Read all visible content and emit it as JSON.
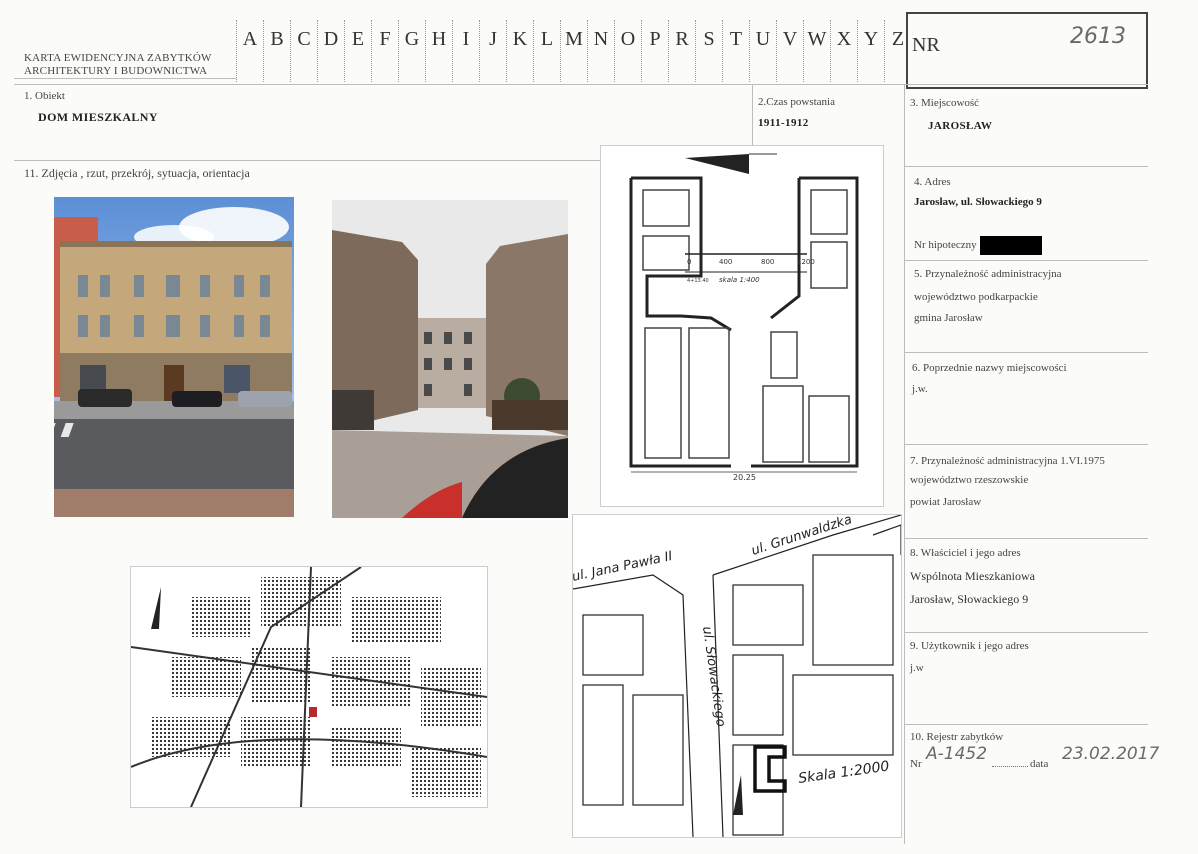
{
  "header": {
    "title_line1": "KARTA EWIDENCYJNA ZABYTKÓW",
    "title_line2": "ARCHITEKTURY I BUDOWNICTWA",
    "letters": [
      "A",
      "B",
      "C",
      "D",
      "E",
      "F",
      "G",
      "H",
      "I",
      "J",
      "K",
      "L",
      "M",
      "N",
      "O",
      "P",
      "R",
      "S",
      "T",
      "U",
      "V",
      "W",
      "X",
      "Y",
      "Z"
    ],
    "nr_label": "NR",
    "nr_value": "2613"
  },
  "sections": {
    "s1_label": "1. Obiekt",
    "s1_value": "DOM MIESZKALNY",
    "s2_label": "2.Czas powstania",
    "s2_value": "1911-1912",
    "s3_label": "3. Miejscowość",
    "s3_value": "JAROSŁAW",
    "s4_label": "4. Adres",
    "s4_value": "Jarosław, ul. Słowackiego 9",
    "s4_hipo": "Nr hipoteczny",
    "s5_label": "5. Przynależność administracyjna",
    "s5_line1": "województwo   podkarpackie",
    "s5_line2": "gmina  Jarosław",
    "s6_label": "6. Poprzednie nazwy miejscowości",
    "s6_value": "j.w.",
    "s7_label": "7. Przynależność administracyjna 1.VI.1975",
    "s7_line1": "województwo  rzeszowskie",
    "s7_line2": "powiat   Jarosław",
    "s8_label": "8. Właściciel i jego adres",
    "s8_line1": "Wspólnota Mieszkaniowa",
    "s8_line2": "Jarosław, Słowackiego 9",
    "s9_label": "9. Użytkownik i jego adres",
    "s9_value": "j.w",
    "s10_label": "10. Rejestr zabytków",
    "s10_nr_prefix": "Nr",
    "s10_nr_value": "A-1452",
    "s10_data_label": "data",
    "s10_data_value": "23.02.2017",
    "s11_label": "11. Zdjęcia , rzut, przekrój, sytuacja, orientacja"
  },
  "plan": {
    "scale_0": "0",
    "scale_400": "400",
    "scale_800": "800",
    "scale_1200": "1200",
    "scale_text": "skala 1:400",
    "dim_text": "20.25",
    "side_text": "4+13.40"
  },
  "situation_map": {
    "street1": "ul. Jana Pawła II",
    "street2": "ul. Grunwaldzka",
    "street3": "ul. Słowackiego",
    "scale": "Skala 1:2000"
  }
}
